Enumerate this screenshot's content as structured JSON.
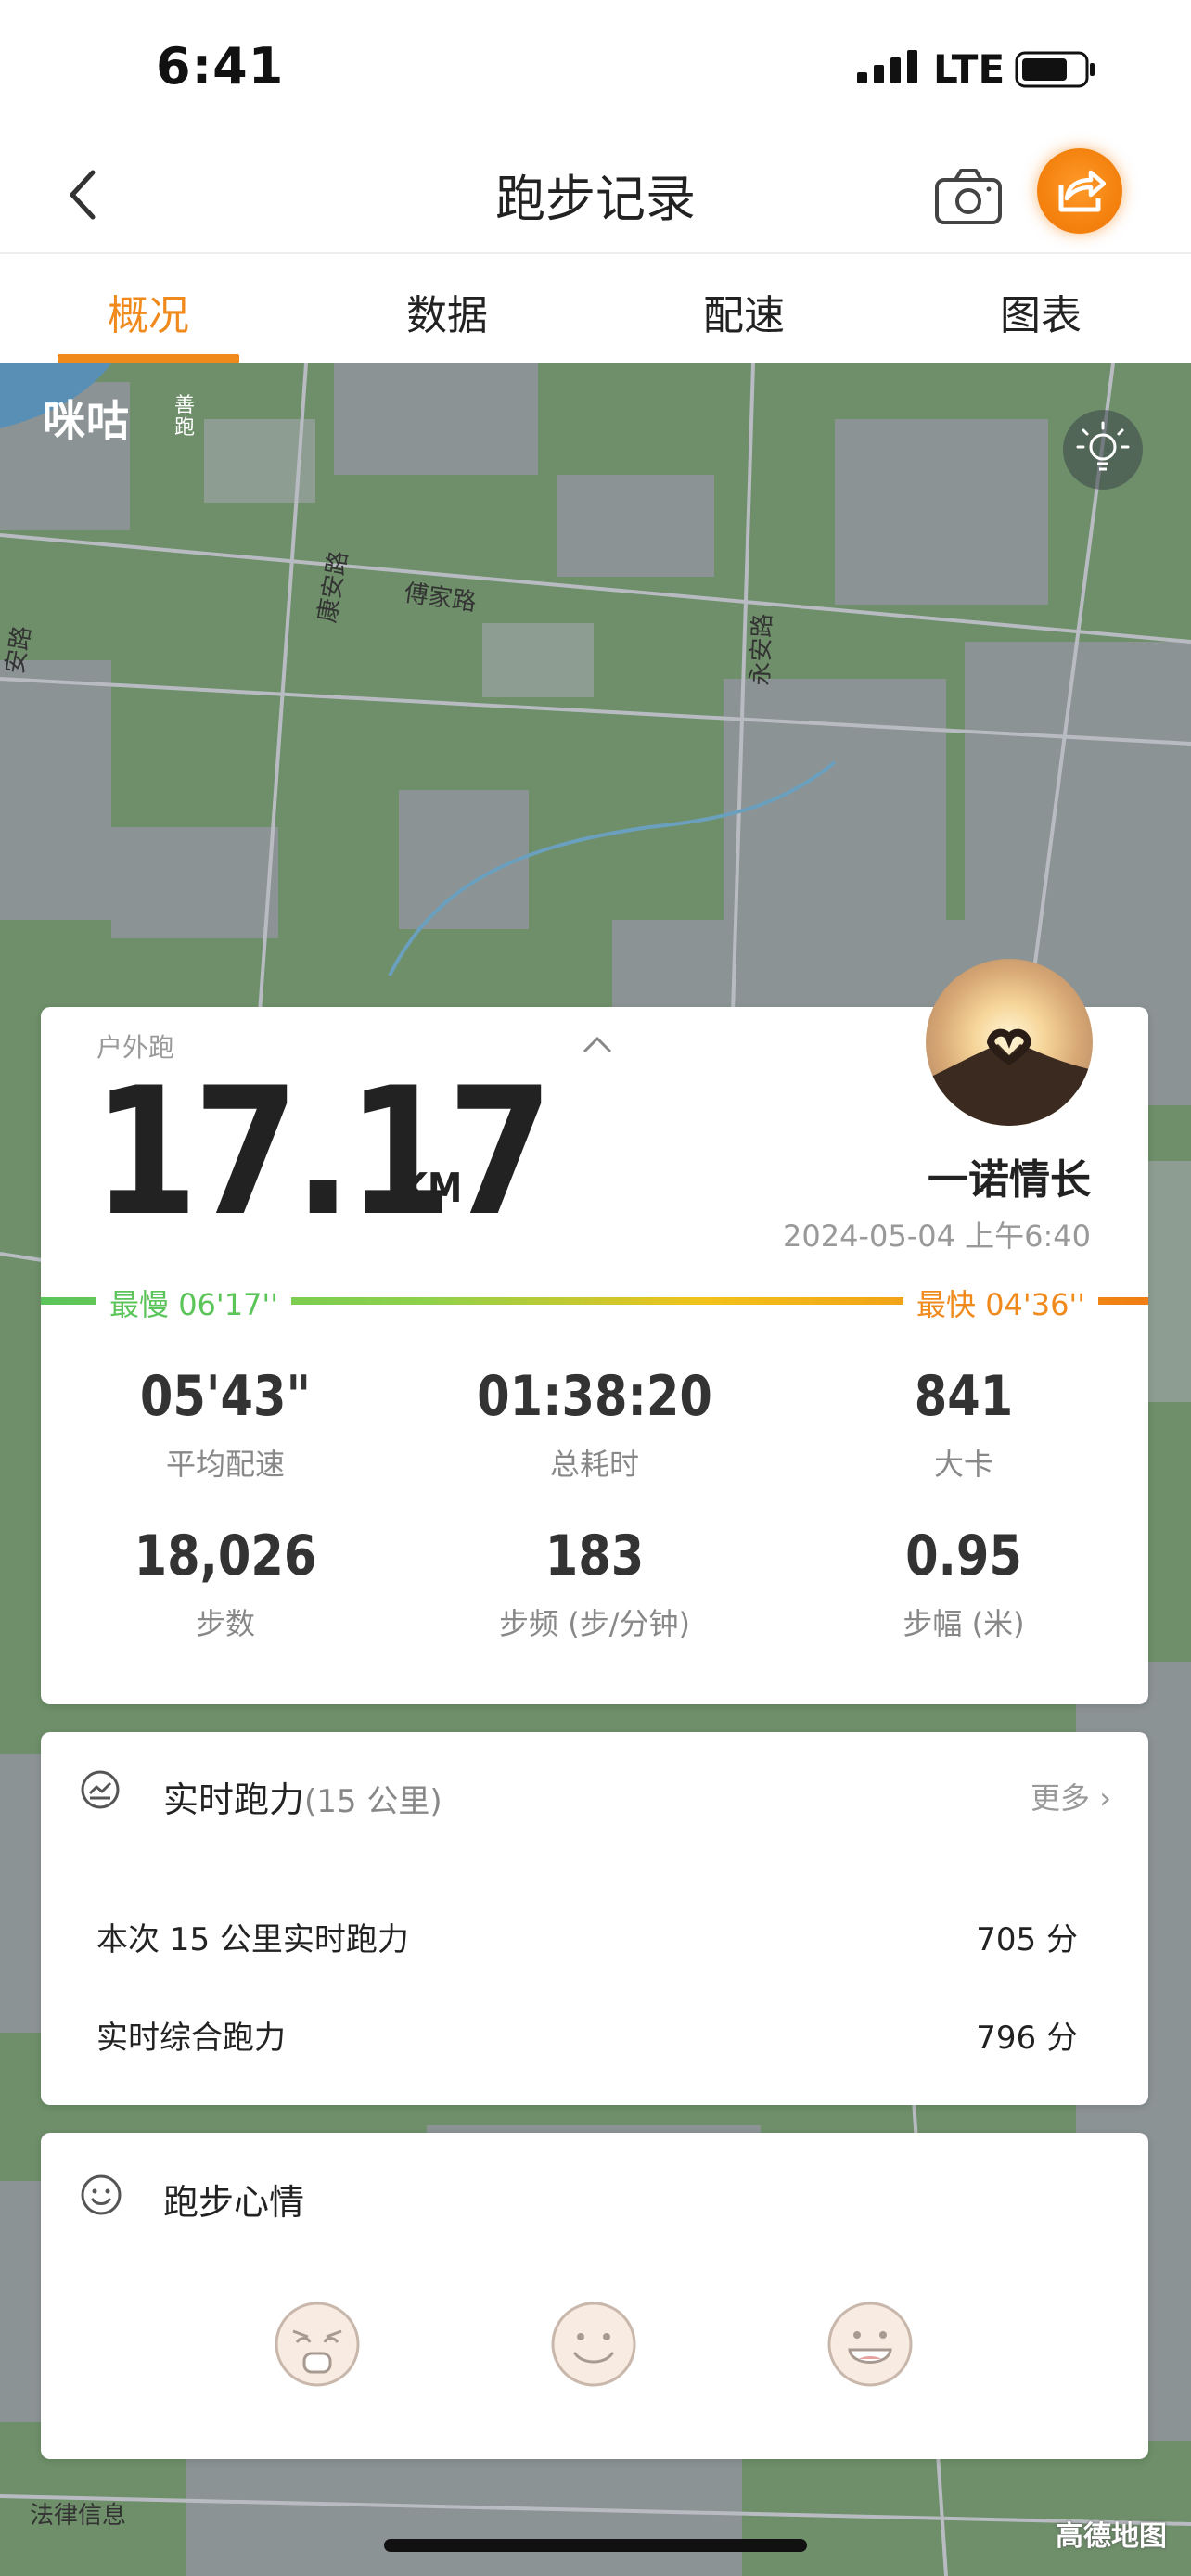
{
  "status_bar": {
    "time": "6:41",
    "network": "LTE"
  },
  "nav": {
    "title": "跑步记录"
  },
  "tabs": [
    {
      "label": "概况",
      "active": true
    },
    {
      "label": "数据",
      "active": false
    },
    {
      "label": "配速",
      "active": false
    },
    {
      "label": "图表",
      "active": false
    }
  ],
  "map": {
    "brand_logo": "咪咕",
    "brand_logo_sub": "善跑",
    "roads": [
      "康安路",
      "傅家路",
      "永安路",
      "安路"
    ],
    "legal_link": "法律信息",
    "provider": "高德地图"
  },
  "summary": {
    "type": "户外跑",
    "distance": "17.17",
    "unit": "KM",
    "user_name": "一诺情长",
    "date": "2024-05-04 上午6:40",
    "slowest_label": "最慢",
    "slowest_pace": "06'17''",
    "fastest_label": "最快",
    "fastest_pace": "04'36''",
    "stats": [
      {
        "value": "05'43\"",
        "label": "平均配速"
      },
      {
        "value": "01:38:20",
        "label": "总耗时"
      },
      {
        "value": "841",
        "label": "大卡"
      },
      {
        "value": "18,026",
        "label": "步数"
      },
      {
        "value": "183",
        "label": "步频 (步/分钟)"
      },
      {
        "value": "0.95",
        "label": "步幅 (米)"
      }
    ]
  },
  "running_power": {
    "title": "实时跑力",
    "subtitle": "(15 公里)",
    "more": "更多",
    "rows": [
      {
        "label": "本次 15 公里实时跑力",
        "value": "705 分"
      },
      {
        "label": "实时综合跑力",
        "value": "796 分"
      }
    ]
  },
  "mood": {
    "title": "跑步心情",
    "options": [
      "tired-face-icon",
      "smile-face-icon",
      "grin-face-icon"
    ]
  },
  "colors": {
    "accent": "#f08a1d",
    "slow": "#5bc55a"
  }
}
